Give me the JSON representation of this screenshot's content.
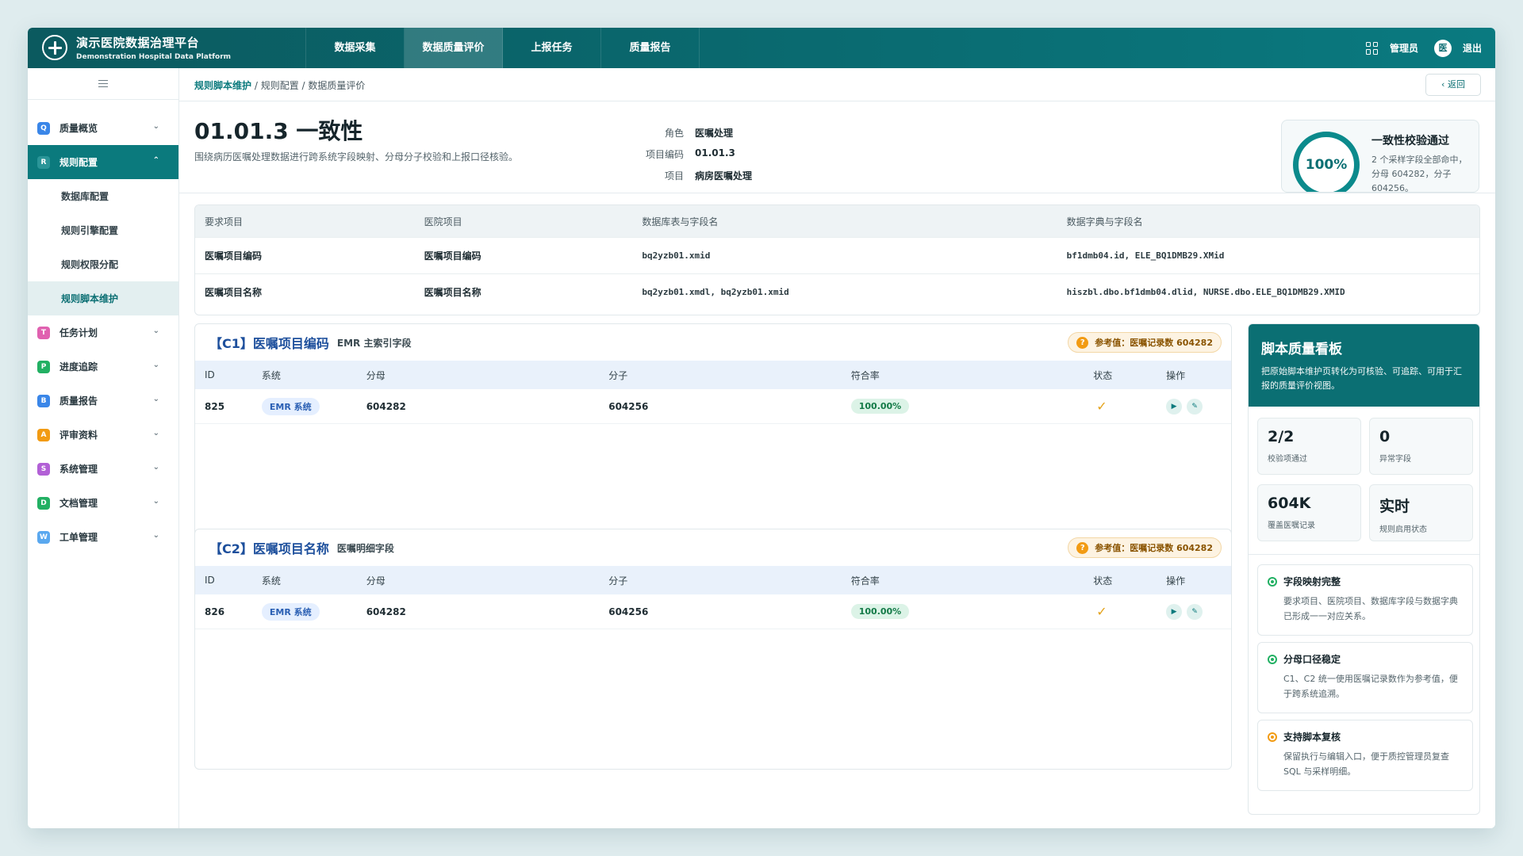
{
  "header": {
    "brand_cn": "演示医院数据治理平台",
    "brand_en": "Demonstration Hospital Data Platform",
    "nav": [
      "数据采集",
      "数据质量评价",
      "上报任务",
      "质量报告"
    ],
    "active_nav_index": 1,
    "user_label": "管理员",
    "avatar_text": "医",
    "logout": "退出"
  },
  "sidebar": {
    "items": [
      {
        "icon": "Q",
        "icon_color": "#3a86e8",
        "label": "质量概览"
      },
      {
        "icon": "R",
        "icon_color": "#0b7a7d",
        "label": "规则配置",
        "active": true
      },
      {
        "icon": "T",
        "icon_color": "#e061b0",
        "label": "任务计划"
      },
      {
        "icon": "P",
        "icon_color": "#22b063",
        "label": "进度追踪"
      },
      {
        "icon": "B",
        "icon_color": "#3a86e8",
        "label": "质量报告"
      },
      {
        "icon": "A",
        "icon_color": "#f29b13",
        "label": "评审资料"
      },
      {
        "icon": "S",
        "icon_color": "#b260d6",
        "label": "系统管理"
      },
      {
        "icon": "D",
        "icon_color": "#22b063",
        "label": "文档管理"
      },
      {
        "icon": "W",
        "icon_color": "#5aa8ef",
        "label": "工单管理"
      }
    ],
    "sub_items": [
      "数据库配置",
      "规则引擎配置",
      "规则权限分配",
      "规则脚本维护"
    ]
  },
  "breadcrumb": {
    "link": "规则脚本维护",
    "rest": " / 规则配置 / 数据质量评价"
  },
  "back_label": "‹ 返回",
  "page": {
    "title": "01.01.3 一致性",
    "desc": "围绕病历医嘱处理数据进行跨系统字段映射、分母分子校验和上报口径核验。",
    "meta": [
      {
        "k": "角色",
        "v": "医嘱处理"
      },
      {
        "k": "项目编码",
        "v": "01.01.3"
      },
      {
        "k": "项目",
        "v": "病房医嘱处理"
      }
    ]
  },
  "pass_card": {
    "percent": "100%",
    "title": "一致性校验通过",
    "desc": "2 个采样字段全部命中，分母 604282，分子 604256。"
  },
  "mapping": {
    "headers": [
      "要求项目",
      "医院项目",
      "数据库表与字段名",
      "数据字典与字段名"
    ],
    "rows": [
      [
        "医嘱项目编码",
        "医嘱项目编码",
        "bq2yzb01.xmid",
        "bf1dmb04.id, ELE_BQ1DMB29.XMid"
      ],
      [
        "医嘱项目名称",
        "医嘱项目名称",
        "bq2yzb01.xmdl, bq2yzb01.xmid",
        "hiszbl.dbo.bf1dmb04.dlid, NURSE.dbo.ELE_BQ1DMB29.XMID"
      ]
    ]
  },
  "rules": [
    {
      "title": "【C1】医嘱项目编码",
      "subtitle": "EMR 主索引字段",
      "ref": "参考值：医嘱记录数 604282",
      "headers": [
        "ID",
        "系统",
        "分母",
        "分子",
        "符合率",
        "状态",
        "操作"
      ],
      "row": {
        "id": "825",
        "system": "EMR 系统",
        "denominator": "604282",
        "numerator": "604256",
        "rate": "100.00%",
        "status": "✓"
      }
    },
    {
      "title": "【C2】医嘱项目名称",
      "subtitle": "医嘱明细字段",
      "ref": "参考值：医嘱记录数 604282",
      "headers": [
        "ID",
        "系统",
        "分母",
        "分子",
        "符合率",
        "状态",
        "操作"
      ],
      "row": {
        "id": "826",
        "system": "EMR 系统",
        "denominator": "604282",
        "numerator": "604256",
        "rate": "100.00%",
        "status": "✓"
      }
    }
  ],
  "board": {
    "title": "脚本质量看板",
    "desc": "把原始脚本维护页转化为可核验、可追踪、可用于汇报的质量评价视图。",
    "stats": [
      {
        "value": "2/2",
        "label": "校验项通过"
      },
      {
        "value": "0",
        "label": "异常字段"
      },
      {
        "value": "604K",
        "label": "覆盖医嘱记录"
      },
      {
        "value": "实时",
        "label": "规则启用状态"
      }
    ],
    "features": [
      {
        "title": "字段映射完整",
        "desc": "要求项目、医院项目、数据库字段与数据字典已形成一一对应关系。",
        "color": "#22b063"
      },
      {
        "title": "分母口径稳定",
        "desc": "C1、C2 统一使用医嘱记录数作为参考值，便于跨系统追溯。",
        "color": "#22b063"
      },
      {
        "title": "支持脚本复核",
        "desc": "保留执行与编辑入口，便于质控管理员复查 SQL 与采样明细。",
        "color": "#f29b13"
      }
    ]
  }
}
